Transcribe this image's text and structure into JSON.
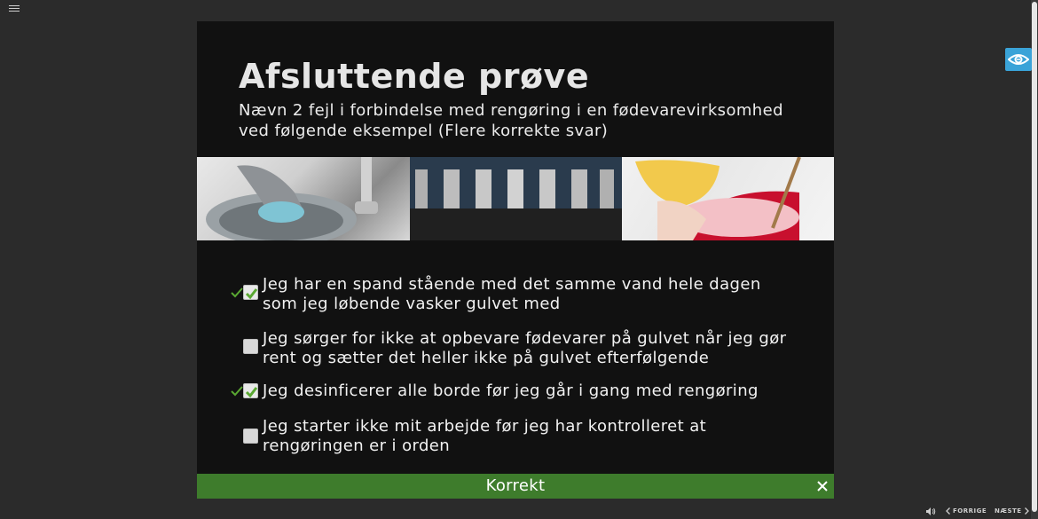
{
  "slide": {
    "title": "Afsluttende prøve",
    "question": "Nævn 2 fejl i forbindelse med rengøring i en fødevarevirksomhed ved følgende eksempel (Flere korrekte svar)"
  },
  "options": [
    {
      "label": "Jeg har en spand stående med det samme vand hele dagen som jeg løbende vasker gulvet med",
      "checked": true,
      "correct_mark": true
    },
    {
      "label": "Jeg sørger for ikke at opbevare fødevarer på gulvet når jeg gør rent og sætter det heller ikke på gulvet efterfølgende",
      "checked": false,
      "correct_mark": false
    },
    {
      "label": "Jeg desinficerer alle borde før jeg går i gang med rengøring",
      "checked": true,
      "correct_mark": true
    },
    {
      "label": "Jeg starter ikke mit arbejde før jeg har kontrolleret at rengøringen er i orden",
      "checked": false,
      "correct_mark": false
    }
  ],
  "result": {
    "text": "Korrekt",
    "color": "#3e7c2c"
  },
  "nav": {
    "prev_label": "FORRIGE",
    "next_label": "NÆSTE"
  },
  "icons": {
    "menu": "hamburger-icon",
    "accessibility": "eye-icon",
    "volume": "speaker-icon",
    "close": "close-icon",
    "check": "checkmark-icon"
  },
  "colors": {
    "accent": "#3aa3d8",
    "check_green": "#5aa832"
  }
}
